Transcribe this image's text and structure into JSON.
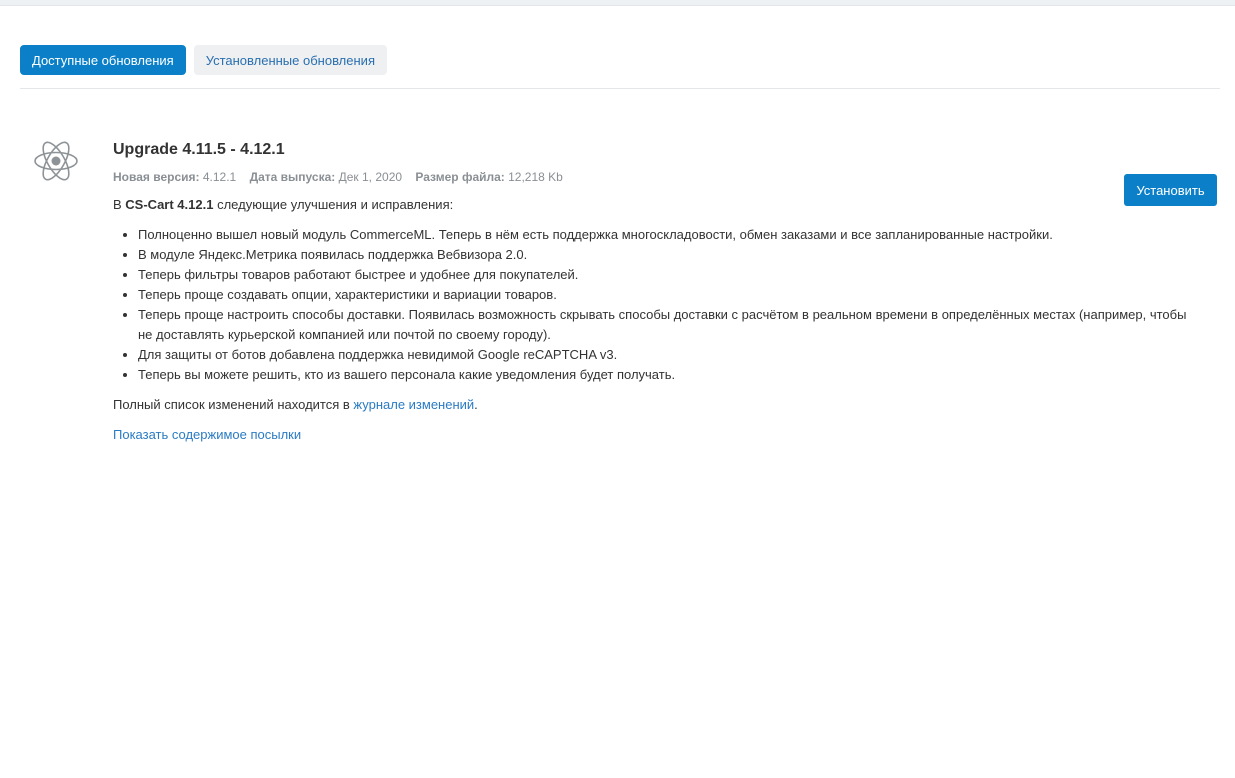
{
  "tabs": [
    {
      "label": "Доступные обновления",
      "active": true
    },
    {
      "label": "Установленные обновления",
      "active": false
    }
  ],
  "package": {
    "icon": "atom-icon",
    "title": "Upgrade 4.11.5 - 4.12.1",
    "meta": {
      "new_version_label": "Новая версия:",
      "new_version_value": "4.12.1",
      "release_date_label": "Дата выпуска:",
      "release_date_value": "Дек 1, 2020",
      "file_size_label": "Размер файла:",
      "file_size_value": "12,218 Kb"
    },
    "intro_prefix": "В",
    "intro_product": "CS-Cart 4.12.1",
    "intro_suffix": "следующие улучшения и исправления:",
    "changes": [
      "Полноценно вышел новый модуль CommerceML. Теперь в нём есть поддержка многоскладовости, обмен заказами и все запланированные настройки.",
      "В модуле Яндекс.Метрика появилась поддержка Вебвизора 2.0.",
      "Теперь фильтры товаров работают быстрее и удобнее для покупателей.",
      "Теперь проще создавать опции, характеристики и вариации товаров.",
      "Теперь проще настроить способы доставки. Появилась возможность скрывать способы доставки с расчётом в реальном времени в определённых местах (например, чтобы не доставлять курьерской компанией или почтой по своему городу).",
      "Для защиты от ботов добавлена поддержка невидимой Google reCAPTCHA v3.",
      "Теперь вы можете решить, кто из вашего персонала какие уведомления будет получать."
    ],
    "full_list_prefix": "Полный список изменений находится в",
    "full_list_link": "журнале изменений",
    "full_list_suffix": ".",
    "show_contents_link": "Показать содержимое посылки",
    "install_button": "Установить"
  },
  "colors": {
    "accent": "#0b80c9",
    "link": "#2a7bc4",
    "muted": "#8a8f94"
  }
}
